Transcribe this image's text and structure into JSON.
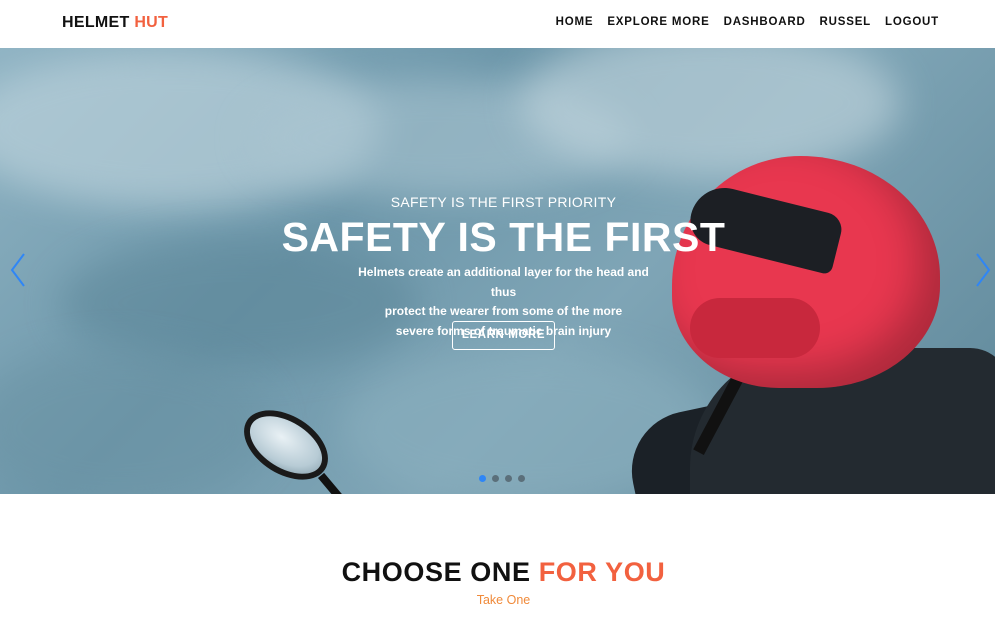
{
  "brand": {
    "part1": "HELMET",
    "part2": " HUT",
    "accent_color": "#f2613f"
  },
  "nav": {
    "items": [
      {
        "label": "HOME"
      },
      {
        "label": "EXPLORE MORE"
      },
      {
        "label": "DASHBOARD"
      },
      {
        "label": "RUSSEL"
      },
      {
        "label": "LOGOUT"
      }
    ]
  },
  "hero": {
    "subtitle": "SAFETY IS THE FIRST PRIORITY",
    "title": "SAFETY IS THE FIRST",
    "text_line1": "Helmets create an additional layer for the head and thus",
    "text_line2": "protect the wearer from some of the more",
    "text_line3": "severe forms of traumatic brain injury",
    "button_label": "LEARN MORE",
    "slide_count": 4,
    "active_slide": 1,
    "indicator_active_color": "#2f86f6",
    "arrow_color": "#2f86f6"
  },
  "section": {
    "title_part1": "CHOOSE ONE",
    "title_part2": " FOR YOU",
    "subtitle": "Take One",
    "subtitle_color": "#f08a3a"
  }
}
